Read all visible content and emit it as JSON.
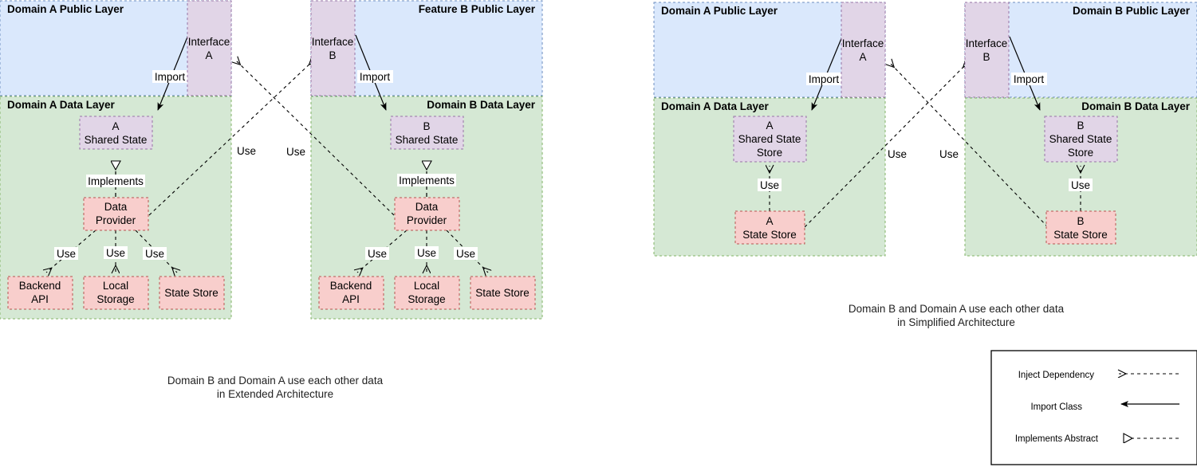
{
  "diagrams": [
    {
      "id": "extended",
      "caption_line1": "Domain B and Domain A use each other data",
      "caption_line2": "in Extended Architecture",
      "layers": [
        {
          "id": "a-public",
          "title": "Domain A Public Layer",
          "title_align": "left",
          "color": "#dae8fc",
          "border": "#6c8ebf"
        },
        {
          "id": "b-public",
          "title": "Feature B Public Layer",
          "title_align": "right",
          "color": "#dae8fc",
          "border": "#6c8ebf"
        },
        {
          "id": "a-data",
          "title": "Domain A Data Layer",
          "title_align": "left",
          "color": "#d5e8d4",
          "border": "#82b366"
        },
        {
          "id": "b-data",
          "title": "Domain B Data Layer",
          "title_align": "right",
          "color": "#d5e8d4",
          "border": "#82b366"
        }
      ],
      "nodes": [
        {
          "id": "iface-a",
          "lines": [
            "Interface",
            "A"
          ],
          "kind": "interface"
        },
        {
          "id": "iface-b",
          "lines": [
            "Interface",
            "B"
          ],
          "kind": "interface"
        },
        {
          "id": "a-shared-state",
          "lines": [
            "A",
            "Shared State"
          ],
          "kind": "interface"
        },
        {
          "id": "b-shared-state",
          "lines": [
            "B",
            "Shared State"
          ],
          "kind": "interface"
        },
        {
          "id": "a-data-provider",
          "lines": [
            "Data",
            "Provider"
          ],
          "kind": "impl"
        },
        {
          "id": "b-data-provider",
          "lines": [
            "Data",
            "Provider"
          ],
          "kind": "impl"
        },
        {
          "id": "a-backend-api",
          "lines": [
            "Backend",
            "API"
          ],
          "kind": "impl"
        },
        {
          "id": "a-local-storage",
          "lines": [
            "Local",
            "Storage"
          ],
          "kind": "impl"
        },
        {
          "id": "a-state-store",
          "lines": [
            "State Store"
          ],
          "kind": "impl"
        },
        {
          "id": "b-backend-api",
          "lines": [
            "Backend",
            "API"
          ],
          "kind": "impl"
        },
        {
          "id": "b-local-storage",
          "lines": [
            "Local",
            "Storage"
          ],
          "kind": "impl"
        },
        {
          "id": "b-state-store",
          "lines": [
            "State Store"
          ],
          "kind": "impl"
        }
      ],
      "edges": [
        {
          "id": "e-import-a",
          "label": "Import",
          "type": "import",
          "from": "iface-a",
          "to": "a-shared-state"
        },
        {
          "id": "e-import-b",
          "label": "Import",
          "type": "import",
          "from": "iface-b",
          "to": "b-shared-state"
        },
        {
          "id": "e-impl-a",
          "label": "Implements",
          "type": "implements",
          "from": "a-data-provider",
          "to": "a-shared-state"
        },
        {
          "id": "e-impl-b",
          "label": "Implements",
          "type": "implements",
          "from": "b-data-provider",
          "to": "b-shared-state"
        },
        {
          "id": "e-cross-a",
          "label": "Use",
          "type": "inject",
          "from": "a-data-provider",
          "to": "iface-b"
        },
        {
          "id": "e-cross-b",
          "label": "Use",
          "type": "inject",
          "from": "b-data-provider",
          "to": "iface-a"
        },
        {
          "id": "e-a-backend",
          "label": "Use",
          "type": "inject",
          "from": "a-data-provider",
          "to": "a-backend-api"
        },
        {
          "id": "e-a-local",
          "label": "Use",
          "type": "inject",
          "from": "a-data-provider",
          "to": "a-local-storage"
        },
        {
          "id": "e-a-store",
          "label": "Use",
          "type": "inject",
          "from": "a-data-provider",
          "to": "a-state-store"
        },
        {
          "id": "e-b-backend",
          "label": "Use",
          "type": "inject",
          "from": "b-data-provider",
          "to": "b-backend-api"
        },
        {
          "id": "e-b-local",
          "label": "Use",
          "type": "inject",
          "from": "b-data-provider",
          "to": "b-local-storage"
        },
        {
          "id": "e-b-store",
          "label": "Use",
          "type": "inject",
          "from": "b-data-provider",
          "to": "b-state-store"
        }
      ]
    },
    {
      "id": "simplified",
      "caption_line1": "Domain B and Domain A use each other data",
      "caption_line2": "in Simplified Architecture",
      "layers": [
        {
          "id": "a-public",
          "title": "Domain A Public Layer",
          "title_align": "left",
          "color": "#dae8fc",
          "border": "#6c8ebf"
        },
        {
          "id": "b-public",
          "title": "Domain B Public Layer",
          "title_align": "right",
          "color": "#dae8fc",
          "border": "#6c8ebf"
        },
        {
          "id": "a-data",
          "title": "Domain A Data Layer",
          "title_align": "left",
          "color": "#d5e8d4",
          "border": "#82b366"
        },
        {
          "id": "b-data",
          "title": "Domain B Data Layer",
          "title_align": "right",
          "color": "#d5e8d4",
          "border": "#82b366"
        }
      ],
      "nodes": [
        {
          "id": "iface-a",
          "lines": [
            "Interface",
            "A"
          ],
          "kind": "interface"
        },
        {
          "id": "iface-b",
          "lines": [
            "Interface",
            "B"
          ],
          "kind": "interface"
        },
        {
          "id": "a-shared-state-store",
          "lines": [
            "A",
            "Shared State",
            "Store"
          ],
          "kind": "interface"
        },
        {
          "id": "b-shared-state-store",
          "lines": [
            "B",
            "Shared State",
            "Store"
          ],
          "kind": "interface"
        },
        {
          "id": "a-state-store",
          "lines": [
            "A",
            "State Store"
          ],
          "kind": "impl"
        },
        {
          "id": "b-state-store",
          "lines": [
            "B",
            "State Store"
          ],
          "kind": "impl"
        }
      ],
      "edges": [
        {
          "id": "e-import-a",
          "label": "Import",
          "type": "import",
          "from": "iface-a",
          "to": "a-shared-state-store"
        },
        {
          "id": "e-import-b",
          "label": "Import",
          "type": "import",
          "from": "iface-b",
          "to": "b-shared-state-store"
        },
        {
          "id": "e-use-a",
          "label": "Use",
          "type": "inject",
          "from": "a-state-store",
          "to": "a-shared-state-store"
        },
        {
          "id": "e-use-b",
          "label": "Use",
          "type": "inject",
          "from": "b-state-store",
          "to": "b-shared-state-store"
        },
        {
          "id": "e-cross-a",
          "label": "Use",
          "type": "inject",
          "from": "a-state-store",
          "to": "iface-b"
        },
        {
          "id": "e-cross-b",
          "label": "Use",
          "type": "inject",
          "from": "b-state-store",
          "to": "iface-a"
        }
      ]
    }
  ],
  "legend": {
    "items": [
      {
        "id": "inject-dependency",
        "label": "Inject Dependency",
        "style": "dashed-open-arrow"
      },
      {
        "id": "import-class",
        "label": "Import Class",
        "style": "solid-filled-arrow"
      },
      {
        "id": "implements-abstract",
        "label": "Implements Abstract",
        "style": "dashed-hollow-triangle"
      }
    ]
  },
  "colors": {
    "public_layer_fill": "#dae8fc",
    "public_layer_stroke": "#6c8ebf",
    "data_layer_fill": "#d5e8d4",
    "data_layer_stroke": "#82b366",
    "interface_fill": "#e1d5e7",
    "interface_stroke": "#9673a6",
    "impl_fill": "#f8cecc",
    "impl_stroke": "#b85450",
    "edge_stroke": "#000000"
  }
}
